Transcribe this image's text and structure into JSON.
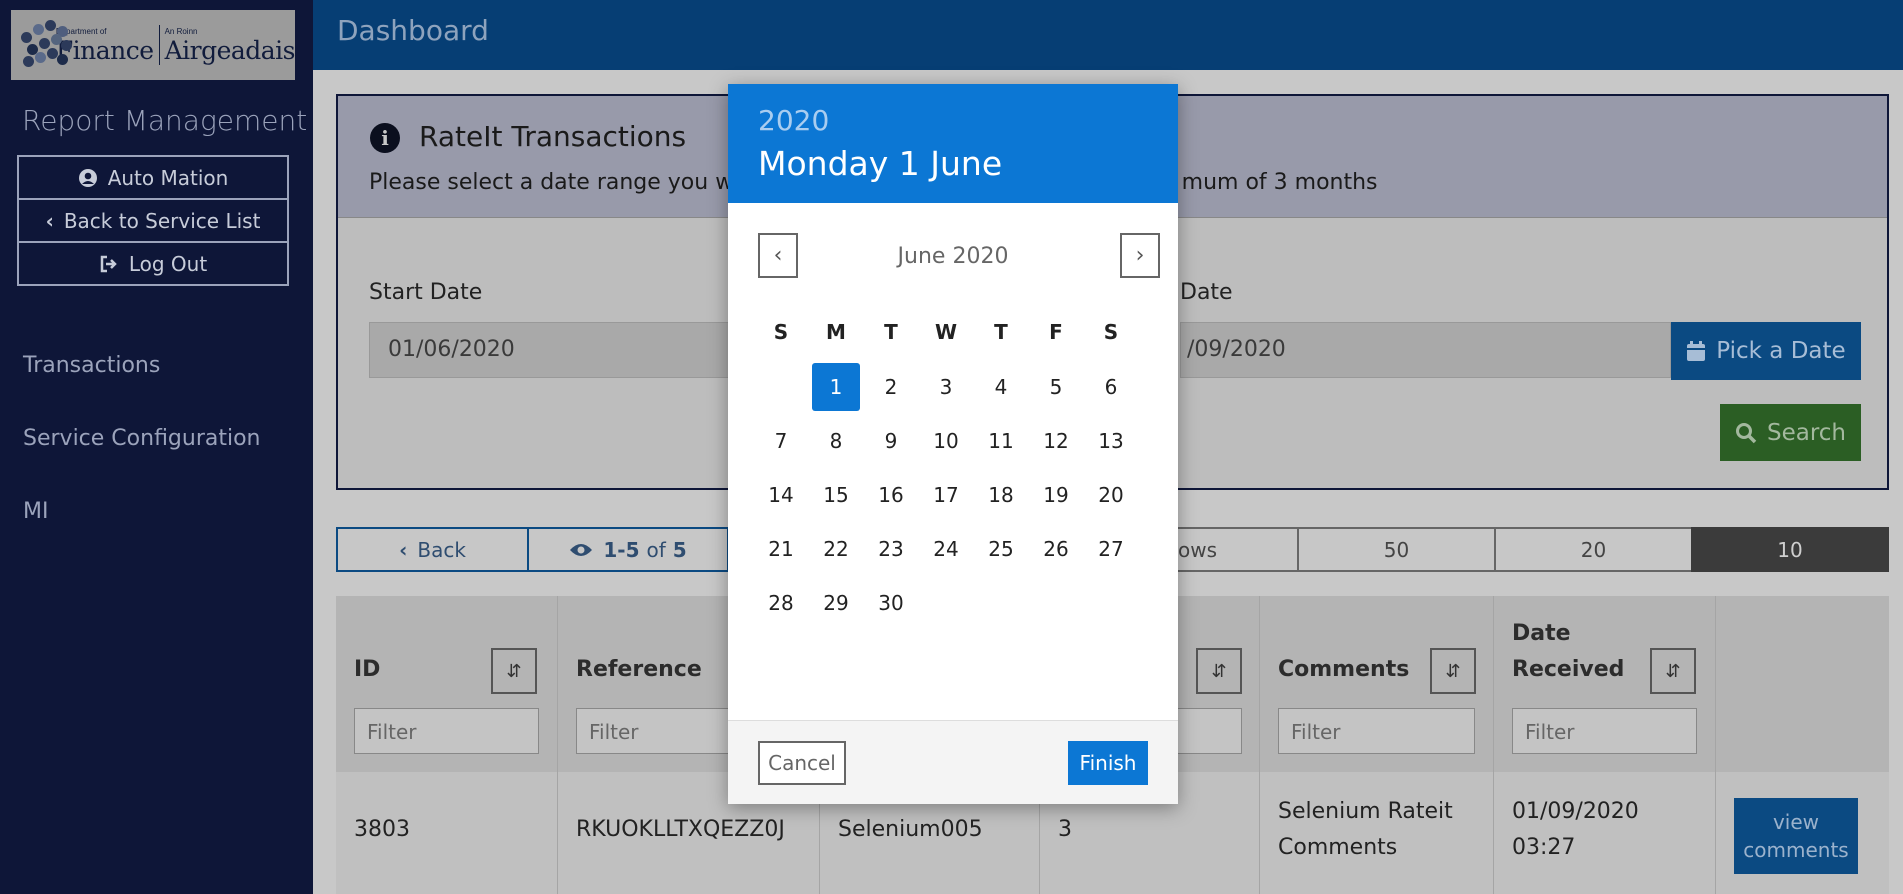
{
  "app": {
    "logo": {
      "dept_small": "Department of",
      "dept_big": "Finance",
      "irish_small": "An Roinn",
      "irish_big": "Airgeadais"
    },
    "topbar_title": "Dashboard"
  },
  "sidebar": {
    "title": "Report Management",
    "buttons": [
      {
        "label": "Auto Mation",
        "icon": "user-circle-icon"
      },
      {
        "label": "Back to Service List",
        "icon": "chevron-left-icon"
      },
      {
        "label": "Log Out",
        "icon": "sign-out-icon"
      }
    ],
    "links": [
      "Transactions",
      "Service Configuration",
      "MI"
    ]
  },
  "panel": {
    "title": "RateIt Transactions",
    "description_left": "Please select a date range you wo",
    "description_right": "mum of 3 months",
    "start_label": "Start Date",
    "start_value": "01/06/2020",
    "end_label": "Date",
    "end_value": "/09/2020",
    "pick_label": "Pick a Date",
    "search_label": "Search"
  },
  "pager": {
    "back_label": "Back",
    "count_range": "1-5",
    "count_of": "of",
    "count_total": "5",
    "rows_partial": "ows",
    "page_sizes": [
      "50",
      "20",
      "10"
    ],
    "active_size": "10"
  },
  "table": {
    "headers": [
      "ID",
      "Reference",
      "Comments",
      "Date Received"
    ],
    "header_date_line1": "Date",
    "header_date_line2": "Received",
    "filter_placeholder": "Filter",
    "row": {
      "id": "3803",
      "reference": "RKUOKLLTXQEZZ0J",
      "user": "Selenium005",
      "rating": "3",
      "comments_line1": "Selenium Rateit",
      "comments_line2": "Comments",
      "date_line1": "01/09/2020",
      "date_line2": "03:27",
      "view_line1": "view",
      "view_line2": "comments"
    }
  },
  "datepicker": {
    "year": "2020",
    "selected_date_text": "Monday 1 June",
    "month_label": "June 2020",
    "weekdays": [
      "S",
      "M",
      "T",
      "W",
      "T",
      "F",
      "S"
    ],
    "first_weekday_index": 1,
    "days_in_month": 30,
    "selected_day": 1,
    "cancel_label": "Cancel",
    "finish_label": "Finish"
  },
  "colors": {
    "accent_blue": "#0c77d4",
    "sidebar_bg": "#0e1638",
    "search_green": "#2b5e24"
  }
}
